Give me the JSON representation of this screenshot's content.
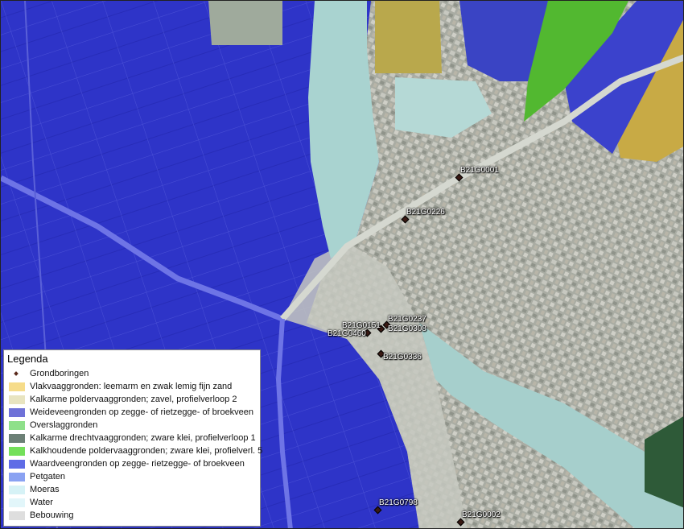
{
  "legend": {
    "title": "Legenda",
    "items": [
      {
        "label": "Grondboringen",
        "kind": "point",
        "color": "#5a2a1c"
      },
      {
        "label": "Vlakvaaggronden: leemarm en zwak lemig fijn zand",
        "kind": "fill",
        "color": "#f6dc8a"
      },
      {
        "label": "Kalkarme poldervaaggronden; zavel, profielverloop 2",
        "kind": "fill",
        "color": "#e8e4c0"
      },
      {
        "label": "Weideveengronden op zegge- of rietzegge- of broekveen",
        "kind": "fill",
        "color": "#6f72d8"
      },
      {
        "label": "Overslaggronden",
        "kind": "fill",
        "color": "#8ee08a"
      },
      {
        "label": "Kalkarme drechtvaaggronden; zware klei, profielverloop 1",
        "kind": "fill",
        "color": "#6c8076"
      },
      {
        "label": "Kalkhoudende poldervaaggronden; zware klei, profielverl. 5",
        "kind": "fill",
        "color": "#74e05a"
      },
      {
        "label": "Waardveengronden op zegge- rietzegge- of broekveen",
        "kind": "fill",
        "color": "#5f6ce6"
      },
      {
        "label": "Petgaten",
        "kind": "fill",
        "color": "#8aa2f2"
      },
      {
        "label": "Moeras",
        "kind": "fill",
        "color": "#d6f2f6"
      },
      {
        "label": "Water",
        "kind": "fill",
        "color": "#e2f6fa"
      },
      {
        "label": "Bebouwing",
        "kind": "fill",
        "color": "#dedede"
      }
    ]
  },
  "boreholes": [
    {
      "id": "B21G0001"
    },
    {
      "id": "B21G0226"
    },
    {
      "id": "B21G0237"
    },
    {
      "id": "B21G0151"
    },
    {
      "id": "B21G0308"
    },
    {
      "id": "B21G0460"
    },
    {
      "id": "B21G0336"
    },
    {
      "id": "B21G0798"
    },
    {
      "id": "B21G0002"
    }
  ],
  "colors": {
    "peat_blue": "#3b3bd6",
    "water": "#9ecfcc",
    "urban": "#b9bbb2",
    "sand_yellow": "#c9b24a",
    "green": "#58c23a",
    "dark_green": "#2f5a3a",
    "highway": "#8a8ef0"
  }
}
